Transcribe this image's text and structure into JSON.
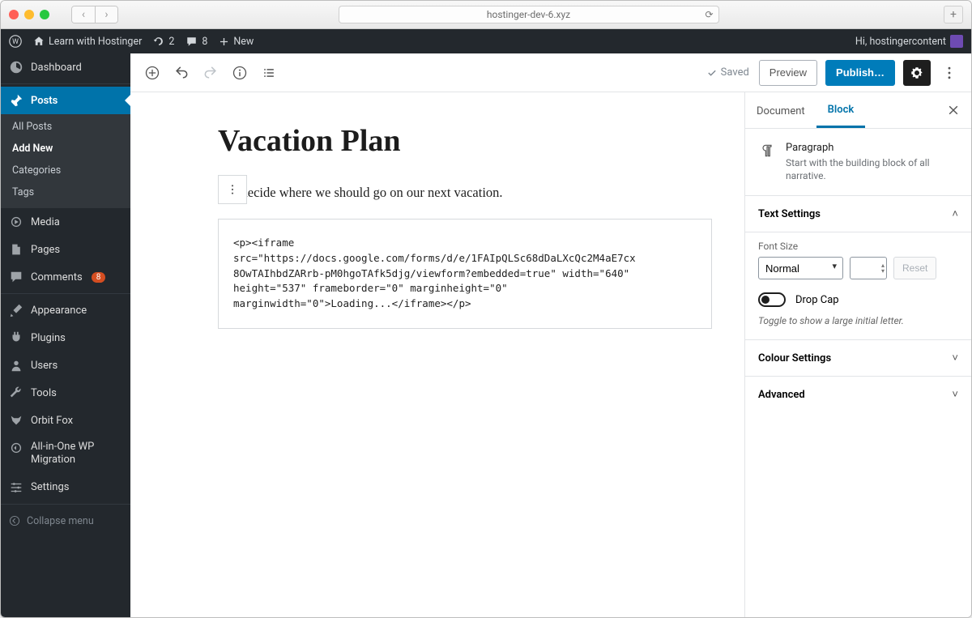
{
  "browser": {
    "url": "hostinger-dev-6.xyz"
  },
  "adminbar": {
    "site": "Learn with Hostinger",
    "updates": "2",
    "comments": "8",
    "new": "New",
    "greeting": "Hi, hostingercontent"
  },
  "sidebar": {
    "dashboard": "Dashboard",
    "posts": "Posts",
    "posts_sub": {
      "all": "All Posts",
      "add": "Add New",
      "cat": "Categories",
      "tags": "Tags"
    },
    "media": "Media",
    "pages": "Pages",
    "comments": "Comments",
    "comments_badge": "8",
    "appearance": "Appearance",
    "plugins": "Plugins",
    "users": "Users",
    "tools": "Tools",
    "orbitfox": "Orbit Fox",
    "aio": "All-in-One WP Migration",
    "settings": "Settings",
    "collapse": "Collapse menu"
  },
  "editor_top": {
    "saved": "Saved",
    "preview": "Preview",
    "publish": "Publish…"
  },
  "post": {
    "title": "Vacation Plan",
    "paragraph": "'s decide where we should go on our next vacation.",
    "codeblock": "<p><iframe\nsrc=\"https://docs.google.com/forms/d/e/1FAIpQLSc68dDaLXcQc2M4aE7cx\n8OwTAIhbdZARrb-pM0hgoTAfk5djg/viewform?embedded=true\" width=\"640\"\nheight=\"537\" frameborder=\"0\" marginheight=\"0\"\nmarginwidth=\"0\">Loading...</iframe></p>"
  },
  "inspector": {
    "tab_document": "Document",
    "tab_block": "Block",
    "block_name": "Paragraph",
    "block_desc": "Start with the building block of all narrative.",
    "text_settings": "Text Settings",
    "font_size_label": "Font Size",
    "font_size_value": "Normal",
    "reset": "Reset",
    "drop_cap": "Drop Cap",
    "drop_cap_hint": "Toggle to show a large initial letter.",
    "colour_settings": "Colour Settings",
    "advanced": "Advanced"
  }
}
